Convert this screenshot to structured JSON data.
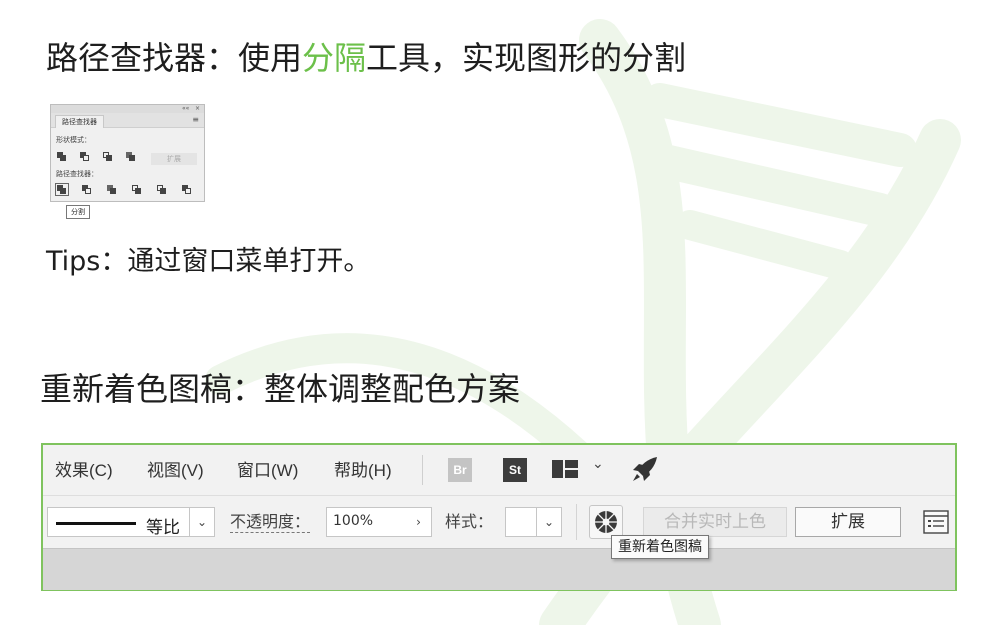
{
  "slide": {
    "heading1_prefix": "路径查找器：使用",
    "heading1_accent": "分隔",
    "heading1_suffix": "工具，实现图形的分割",
    "tips": "Tips：通过窗口菜单打开。",
    "heading2": "重新着色图稿：整体调整配色方案",
    "accent_color": "#6cc04a"
  },
  "pathfinder_panel": {
    "tab_label": "路径查找器",
    "shape_modes_label": "形状模式：",
    "pathfinders_label": "路径查找器：",
    "expand_label": "扩展",
    "collapse_glyph": "««",
    "close_glyph": "×",
    "menu_glyph": "≡",
    "tooltip": "分割"
  },
  "toolbar": {
    "menu": [
      "效果(C)",
      "视图(V)",
      "窗口(W)",
      "帮助(H)"
    ],
    "br_badge": "Br",
    "st_badge": "St",
    "chevron": "⌄",
    "stroke_profile": "等比",
    "dropdown_glyph": "⌄",
    "next_glyph": "›",
    "opacity_label": "不透明度：",
    "opacity_value": "100%",
    "style_label": "样式：",
    "merge_live_paint": "合并实时上色",
    "expand": "扩展",
    "recolor_tooltip": "重新着色图稿",
    "border_color": "#7fc35e"
  }
}
